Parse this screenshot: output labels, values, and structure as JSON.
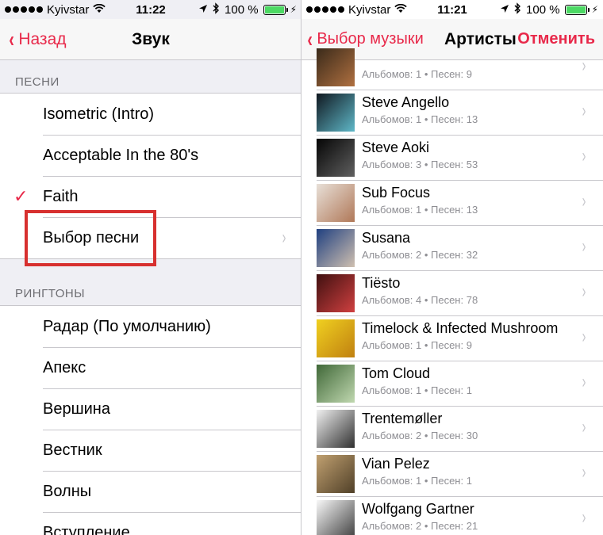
{
  "left": {
    "status": {
      "carrier": "Kyivstar",
      "time": "11:22",
      "battery": "100 %"
    },
    "nav": {
      "back_label": "Назад",
      "title": "Звук"
    },
    "songs_header": "ПЕСНИ",
    "songs": [
      {
        "label": "Isometric (Intro)",
        "checked": false
      },
      {
        "label": "Acceptable In the 80's",
        "checked": false
      },
      {
        "label": "Faith",
        "checked": true
      },
      {
        "label": "Выбор песни",
        "checked": false
      }
    ],
    "ringtones_header": "РИНГТОНЫ",
    "ringtones": [
      {
        "label": "Радар (По умолчанию)"
      },
      {
        "label": "Апекс"
      },
      {
        "label": "Вершина"
      },
      {
        "label": "Вестник"
      },
      {
        "label": "Волны"
      },
      {
        "label": "Вступление"
      }
    ]
  },
  "right": {
    "status": {
      "carrier": "Kyivstar",
      "time": "11:21",
      "battery": "100 %"
    },
    "nav": {
      "back_label": "Выбор музыки",
      "title": "Артисты",
      "cancel_label": "Отменить"
    },
    "artists": [
      {
        "name": "",
        "meta": "Альбомов: 1 • Песен: 9",
        "thumb": [
          "#3a2a1a",
          "#b07040"
        ]
      },
      {
        "name": "Steve Angello",
        "meta": "Альбомов: 1 • Песен: 13",
        "thumb": [
          "#101820",
          "#5fb8c8"
        ]
      },
      {
        "name": "Steve Aoki",
        "meta": "Альбомов: 3 • Песен: 53",
        "thumb": [
          "#050505",
          "#606060"
        ]
      },
      {
        "name": "Sub Focus",
        "meta": "Альбомов: 1 • Песен: 13",
        "thumb": [
          "#e8e0d8",
          "#b07858"
        ]
      },
      {
        "name": "Susana",
        "meta": "Альбомов: 2 • Песен: 32",
        "thumb": [
          "#204080",
          "#d0c0b0"
        ]
      },
      {
        "name": "Tiësto",
        "meta": "Альбомов: 4 • Песен: 78",
        "thumb": [
          "#401010",
          "#d04040"
        ]
      },
      {
        "name": "Timelock & Infected Mushroom",
        "meta": "Альбомов: 1 • Песен: 9",
        "thumb": [
          "#f0d020",
          "#c08010"
        ]
      },
      {
        "name": "Tom Cloud",
        "meta": "Альбомов: 1 • Песен: 1",
        "thumb": [
          "#406838",
          "#c0d8b0"
        ]
      },
      {
        "name": "Trentemøller",
        "meta": "Альбомов: 2 • Песен: 30",
        "thumb": [
          "#f0f0f0",
          "#303030"
        ]
      },
      {
        "name": "Vian Pelez",
        "meta": "Альбомов: 1 • Песен: 1",
        "thumb": [
          "#c0a070",
          "#504028"
        ]
      },
      {
        "name": "Wolfgang Gartner",
        "meta": "Альбомов: 2 • Песен: 21",
        "thumb": [
          "#f8f8f8",
          "#404040"
        ]
      }
    ]
  },
  "colors": {
    "accent": "#e8294a",
    "highlight": "#d7302f",
    "battery": "#4cd964"
  }
}
